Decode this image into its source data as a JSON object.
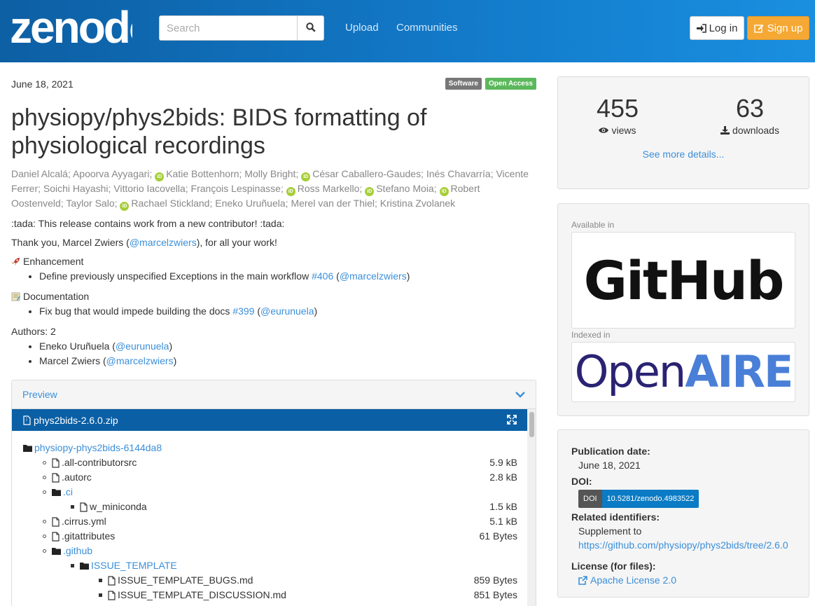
{
  "nav": {
    "logo_text": "zenodo",
    "search_placeholder": "Search",
    "links": [
      "Upload",
      "Communities"
    ],
    "login": "Log in",
    "signup": "Sign up"
  },
  "record": {
    "date": "June 18, 2021",
    "badges": [
      "Software",
      "Open Access"
    ],
    "badge_colors": [
      "#777777",
      "#5cb85c"
    ],
    "title": "physiopy/phys2bids: BIDS formatting of physiological recordings",
    "authors": [
      {
        "name": "Daniel Alcalá",
        "orcid": false
      },
      {
        "name": "Apoorva Ayyagari",
        "orcid": false
      },
      {
        "name": "Katie Bottenhorn",
        "orcid": true
      },
      {
        "name": "Molly Bright",
        "orcid": false
      },
      {
        "name": "César Caballero-Gaudes",
        "orcid": true
      },
      {
        "name": "Inés Chavarría",
        "orcid": false
      },
      {
        "name": "Vicente Ferrer",
        "orcid": false
      },
      {
        "name": "Soichi Hayashi",
        "orcid": false
      },
      {
        "name": "Vittorio Iacovella",
        "orcid": false
      },
      {
        "name": "François Lespinasse",
        "orcid": false
      },
      {
        "name": "Ross Markello",
        "orcid": true
      },
      {
        "name": "Stefano Moia",
        "orcid": true
      },
      {
        "name": "Robert Oostenveld",
        "orcid": true
      },
      {
        "name": "Taylor Salo",
        "orcid": false
      },
      {
        "name": "Rachael Stickland",
        "orcid": true
      },
      {
        "name": "Eneko Uruñuela",
        "orcid": false
      },
      {
        "name": "Merel van der Thiel",
        "orcid": false
      },
      {
        "name": "Kristina Zvolanek",
        "orcid": false
      }
    ],
    "orcid_label": "iD",
    "desc": {
      "p1": ":tada: This release contains work from a new contributor! :tada:",
      "p2_pre": "Thank you, Marcel Zwiers (",
      "p2_link": "@marcelzwiers",
      "p2_post": "), for all your work!",
      "enh_heading": "Enhancement",
      "enh_text": "Define previously unspecified Exceptions in the main workflow ",
      "enh_issue": "#406",
      "enh_user": "@marcelzwiers",
      "doc_heading": "Documentation",
      "doc_text": "Fix bug that would impede building the docs ",
      "doc_issue": "#399",
      "doc_user": "@eurunuela",
      "authors_heading": "Authors: 2",
      "author1": "Eneko Uruñuela (",
      "author1_link": "@eurunuela",
      "author2": "Marcel Zwiers (",
      "author2_link": "@marcelzwiers"
    }
  },
  "preview": {
    "label": "Preview",
    "file": "phys2bids-2.6.0.zip",
    "tree": [
      {
        "name": "physiopy-phys2bids-6144da8",
        "type": "folder",
        "level": 0,
        "size": ""
      },
      {
        "name": ".all-contributorsrc",
        "type": "file",
        "level": 1,
        "size": "5.9 kB"
      },
      {
        "name": ".autorc",
        "type": "file",
        "level": 1,
        "size": "2.8 kB"
      },
      {
        "name": ".ci",
        "type": "folder",
        "level": 1,
        "size": ""
      },
      {
        "name": "w_miniconda",
        "type": "file",
        "level": 2,
        "size": "1.5 kB"
      },
      {
        "name": ".cirrus.yml",
        "type": "file",
        "level": 1,
        "size": "5.1 kB"
      },
      {
        "name": ".gitattributes",
        "type": "file",
        "level": 1,
        "size": "61 Bytes"
      },
      {
        "name": ".github",
        "type": "folder",
        "level": 1,
        "size": ""
      },
      {
        "name": "ISSUE_TEMPLATE",
        "type": "folder",
        "level": 2,
        "size": ""
      },
      {
        "name": "ISSUE_TEMPLATE_BUGS.md",
        "type": "file",
        "level": 3,
        "size": "859 Bytes"
      },
      {
        "name": "ISSUE_TEMPLATE_DISCUSSION.md",
        "type": "file",
        "level": 3,
        "size": "851 Bytes"
      }
    ]
  },
  "stats": {
    "views": "455",
    "views_label": "views",
    "downloads": "63",
    "downloads_label": "downloads",
    "more": "See more details..."
  },
  "available": {
    "label": "Available in",
    "logo": "GitHub",
    "indexed_label": "Indexed in",
    "indexed_logo_a": "Open",
    "indexed_logo_b": "AIRE"
  },
  "meta": {
    "pub_date_label": "Publication date:",
    "pub_date": "June 18, 2021",
    "doi_label": "DOI:",
    "doi_prefix": "DOI",
    "doi": "10.5281/zenodo.4983522",
    "related_label": "Related identifiers:",
    "related_type": "Supplement to",
    "related_url": "https://github.com/physiopy/phys2bids/tree/2.6.0",
    "license_label": "License (for files):",
    "license": "Apache License 2.0"
  }
}
